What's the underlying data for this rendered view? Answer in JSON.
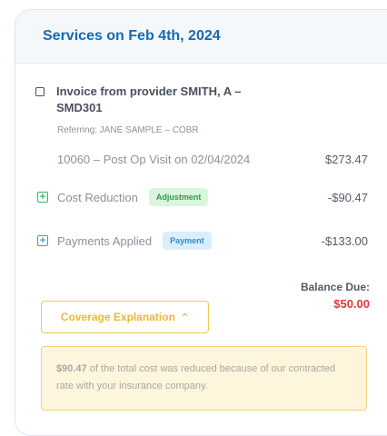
{
  "header": {
    "title": "Services on Feb 4th, 2024"
  },
  "invoice": {
    "title": "Invoice from provider SMITH, A – SMD301",
    "referring": "Referring: JANE SAMPLE – COBR"
  },
  "line_item": {
    "label": "10060 – Post Op Visit on 02/04/2024",
    "amount": "$273.47"
  },
  "adjustments": [
    {
      "label": "Cost Reduction",
      "badge": "Adjustment",
      "amount": "-$90.47",
      "icon": "plus-square-icon",
      "color": "#2eb85c"
    },
    {
      "label": "Payments Applied",
      "badge": "Payment",
      "amount": "-$133.00",
      "icon": "plus-square-icon",
      "color": "#2ba5c8"
    }
  ],
  "balance": {
    "label": "Balance Due:",
    "value": "$50.00"
  },
  "coverage": {
    "button_label": "Coverage Explanation",
    "icon": "chevron-up-icon",
    "note_amount": "$90.47",
    "note_text": " of the total cost was reduced because of our contracted rate with your insurance company."
  }
}
